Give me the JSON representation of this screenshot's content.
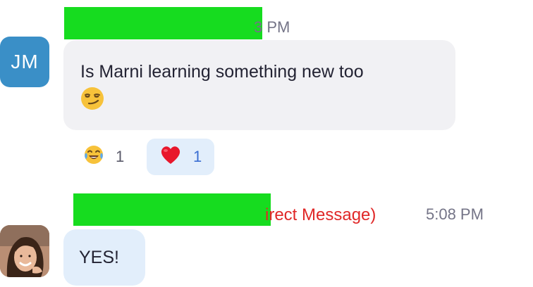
{
  "messages": [
    {
      "sender_initials": "JM",
      "time": "3 PM",
      "text": "Is Marni learning something new too",
      "emoji": "smirking-face",
      "reactions": [
        {
          "emoji": "face-with-tears-of-joy",
          "count": "1"
        },
        {
          "emoji": "red-heart",
          "count": "1"
        }
      ]
    },
    {
      "label": "irect Message)",
      "time": "5:08 PM",
      "text": "YES!"
    }
  ],
  "colors": {
    "redaction": "#16dc1f",
    "avatar_initials_bg": "#3a8fc7",
    "incoming_bubble": "#f1f1f4",
    "own_bubble": "#e2eefb",
    "dm_label": "#e02828",
    "reaction_count_active": "#3a6ed2",
    "timestamp": "#747487"
  }
}
